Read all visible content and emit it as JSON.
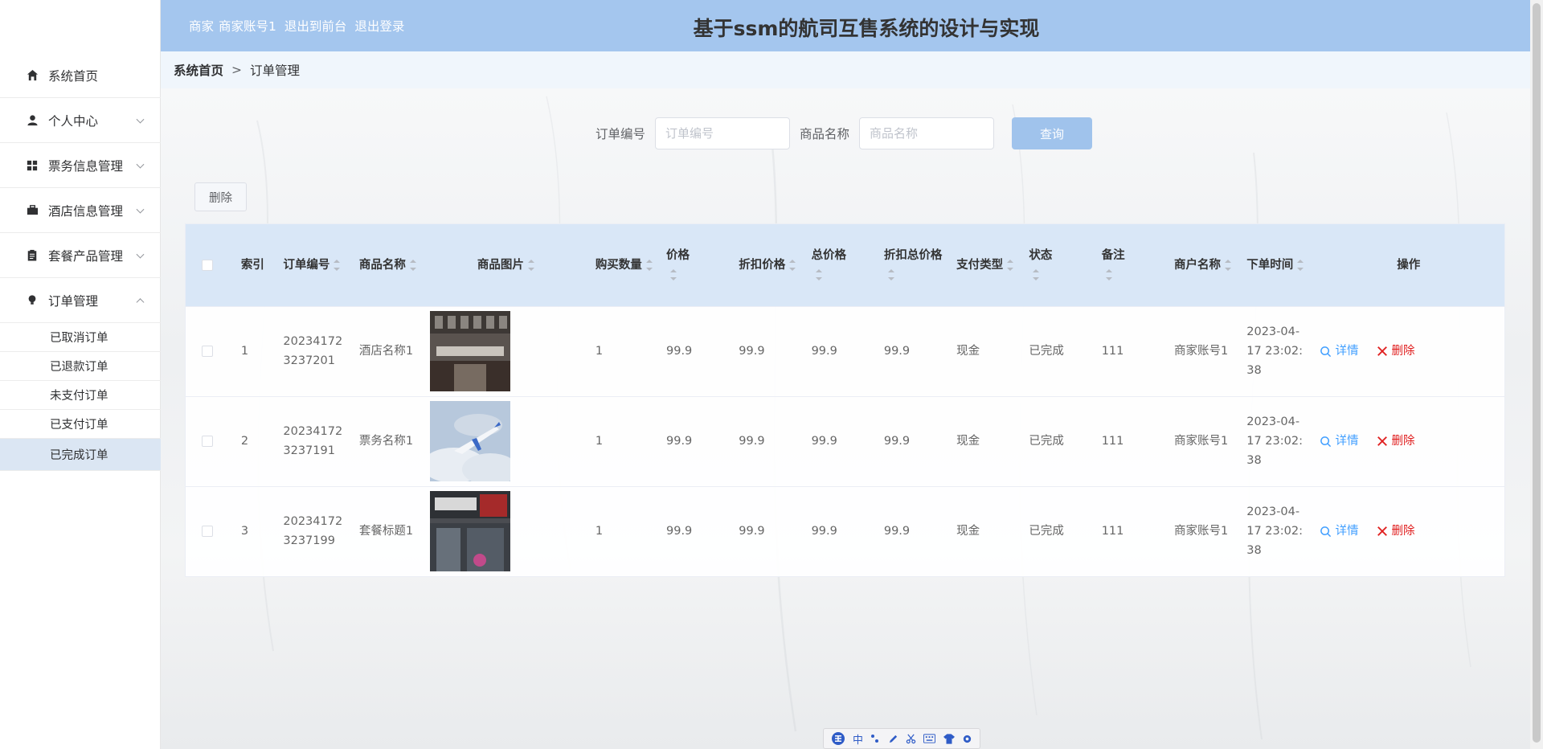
{
  "header": {
    "user_role": "商家",
    "user_name": "商家账号1",
    "to_front_label": "退出到前台",
    "logout_label": "退出登录",
    "title": "基于ssm的航司互售系统的设计与实现"
  },
  "breadcrumb": {
    "home": "系统首页",
    "separator": ">",
    "current": "订单管理"
  },
  "sidebar": {
    "items": [
      {
        "label": "系统首页",
        "icon": "home-icon"
      },
      {
        "label": "个人中心",
        "icon": "user-icon"
      },
      {
        "label": "票务信息管理",
        "icon": "grid-icon"
      },
      {
        "label": "酒店信息管理",
        "icon": "briefcase-icon"
      },
      {
        "label": "套餐产品管理",
        "icon": "clipboard-icon"
      },
      {
        "label": "订单管理",
        "icon": "bulb-icon"
      }
    ],
    "subitems": [
      "已取消订单",
      "已退款订单",
      "未支付订单",
      "已支付订单",
      "已完成订单"
    ],
    "active_subitem": "已完成订单"
  },
  "search": {
    "order_no_label": "订单编号",
    "order_no_placeholder": "订单编号",
    "product_label": "商品名称",
    "product_placeholder": "商品名称",
    "query_label": "查询"
  },
  "actions": {
    "batch_delete_label": "删除"
  },
  "table": {
    "headers": {
      "index": "索引",
      "order_no": "订单编号",
      "product_name": "商品名称",
      "product_image": "商品图片",
      "quantity": "购买数量",
      "price": "价格",
      "discount_price": "折扣价格",
      "total_price": "总价格",
      "discount_total": "折扣总价格",
      "pay_type": "支付类型",
      "status": "状态",
      "remark": "备注",
      "merchant": "商户名称",
      "order_time": "下单时间",
      "operation": "操作"
    },
    "detail_label": "详情",
    "delete_label": "删除",
    "rows": [
      {
        "index": "1",
        "order_no": "202341723237201",
        "product_name": "酒店名称1",
        "image": "hotel-photo",
        "quantity": "1",
        "price": "99.9",
        "discount_price": "99.9",
        "total_price": "99.9",
        "discount_total": "99.9",
        "pay_type": "现金",
        "status": "已完成",
        "remark": "111",
        "merchant": "商家账号1",
        "order_time": "2023-04-17 23:02:38"
      },
      {
        "index": "2",
        "order_no": "202341723237191",
        "product_name": "票务名称1",
        "image": "airplane-photo",
        "quantity": "1",
        "price": "99.9",
        "discount_price": "99.9",
        "total_price": "99.9",
        "discount_total": "99.9",
        "pay_type": "现金",
        "status": "已完成",
        "remark": "111",
        "merchant": "商家账号1",
        "order_time": "2023-04-17 23:02:38"
      },
      {
        "index": "3",
        "order_no": "202341723237199",
        "product_name": "套餐标题1",
        "image": "storefront-photo",
        "quantity": "1",
        "price": "99.9",
        "discount_price": "99.9",
        "total_price": "99.9",
        "discount_total": "99.9",
        "pay_type": "现金",
        "status": "已完成",
        "remark": "111",
        "merchant": "商家账号1",
        "order_time": "2023-04-17 23:02:38"
      }
    ]
  },
  "ime": {
    "lang": "中"
  },
  "colors": {
    "header_bg": "#a4c6ee",
    "breadcrumb_bg": "#f0f6fc",
    "table_head_bg": "#d9e7f7",
    "detail": "#409eff",
    "delete": "#e02020"
  }
}
